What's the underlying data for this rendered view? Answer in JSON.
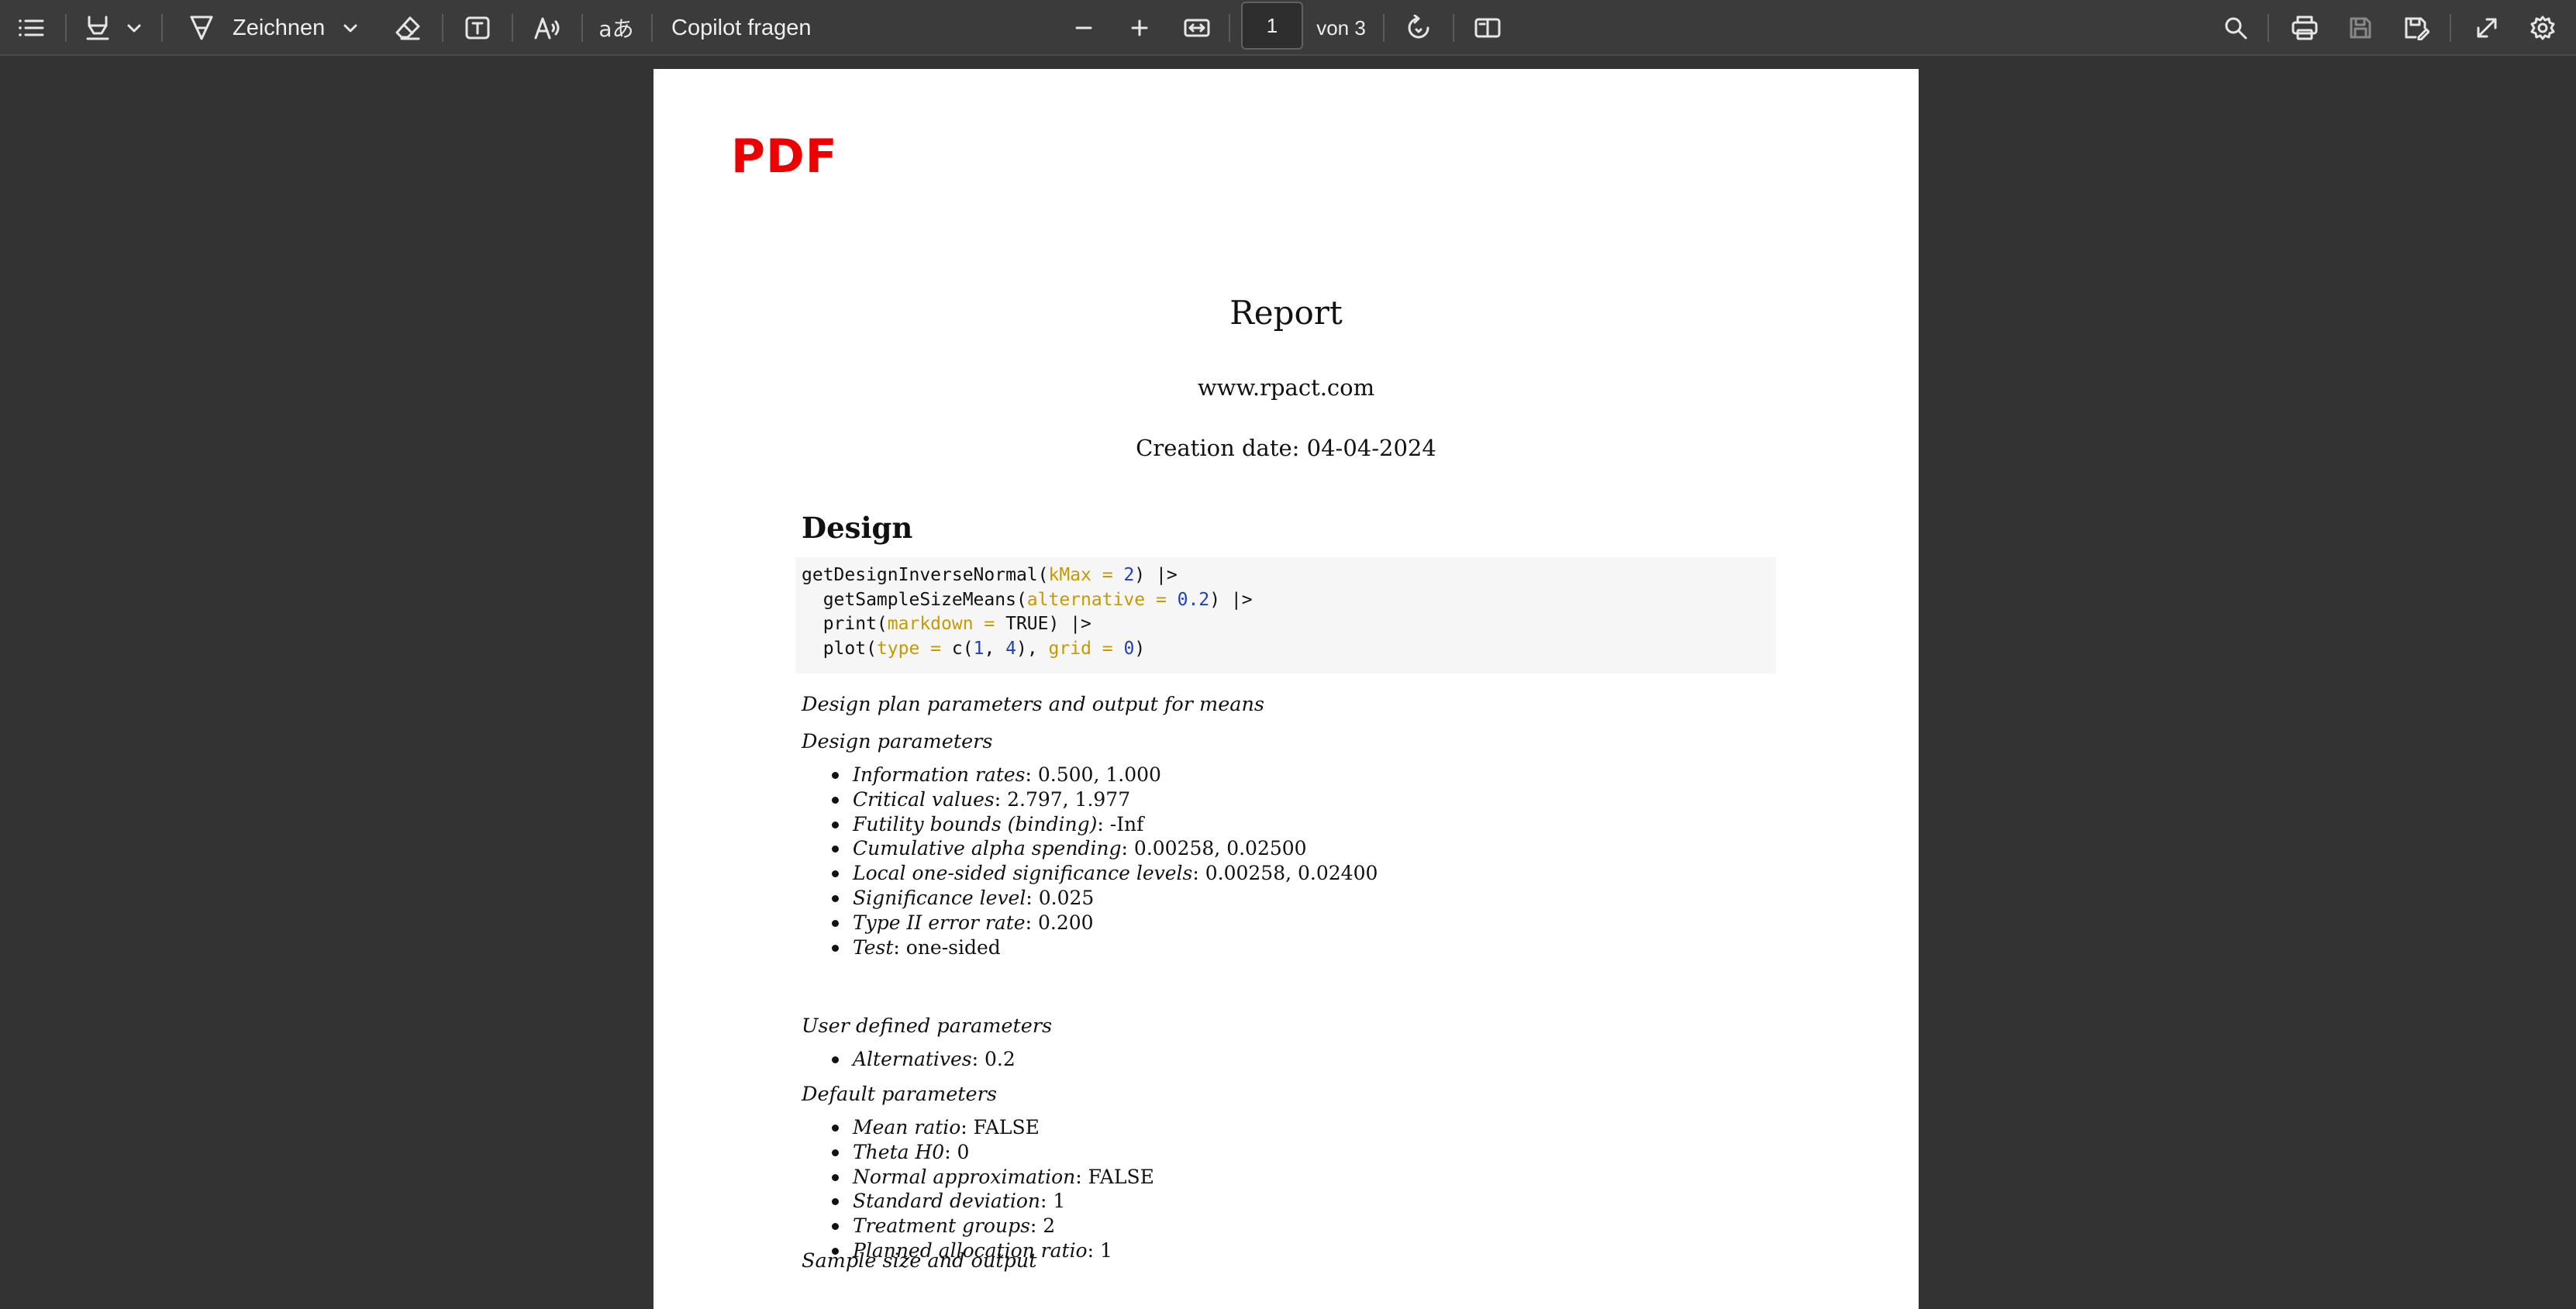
{
  "toolbar": {
    "draw_label": "Zeichnen",
    "copilot_label": "Copilot fragen",
    "page_number": "1",
    "page_total": "von 3",
    "icons": [
      "list-icon",
      "highlighter-icon",
      "chevron-down-icon",
      "draw-icon",
      "chevron-down-icon",
      "eraser-icon",
      "text-box-icon",
      "read-aloud-icon",
      "translate-icon",
      "zoom-out-icon",
      "zoom-in-icon",
      "fit-width-icon",
      "rotate-icon",
      "page-view-icon",
      "search-icon",
      "print-icon",
      "save-icon",
      "save-as-icon",
      "fullscreen-icon",
      "settings-icon"
    ]
  },
  "document": {
    "logo": "PDF",
    "title": "Report",
    "url": "www.rpact.com",
    "creation_date": "Creation date: 04-04-2024",
    "design_heading": "Design",
    "code": {
      "line1": {
        "fn": "getDesignInverseNormal(",
        "arg": "kMax = ",
        "num": "2",
        "rest": ") |>"
      },
      "line2": {
        "fn": "  getSampleSizeMeans(",
        "arg": "alternative = ",
        "num": "0.2",
        "rest": ") |>"
      },
      "line3": {
        "fn": "  print(",
        "arg": "markdown = ",
        "rest": "TRUE) |>"
      },
      "line4": {
        "fn": "  plot(",
        "arg1": "type = ",
        "mid1": "c(",
        "num1": "1",
        "mid2": ", ",
        "num2": "4",
        "mid3": "), ",
        "arg2": "grid = ",
        "num3": "0",
        "rest": ")"
      }
    },
    "design_plan_caption": "Design plan parameters and output for means",
    "design_parameters_heading": "Design parameters",
    "design_parameters": [
      {
        "label": "Information rates",
        "value": ": 0.500, 1.000"
      },
      {
        "label": "Critical values",
        "value": ": 2.797, 1.977"
      },
      {
        "label": "Futility bounds (binding)",
        "value": ": -Inf"
      },
      {
        "label": "Cumulative alpha spending",
        "value": ": 0.00258, 0.02500"
      },
      {
        "label": "Local one-sided significance levels",
        "value": ": 0.00258, 0.02400"
      },
      {
        "label": "Significance level",
        "value": ": 0.025"
      },
      {
        "label": "Type II error rate",
        "value": ": 0.200"
      },
      {
        "label": "Test",
        "value": ": one-sided"
      }
    ],
    "user_defined_heading": "User defined parameters",
    "user_defined_parameters": [
      {
        "label": "Alternatives",
        "value": ": 0.2"
      }
    ],
    "default_heading": "Default parameters",
    "default_parameters": [
      {
        "label": "Mean ratio",
        "value": ": FALSE"
      },
      {
        "label": "Theta H0",
        "value": ": 0"
      },
      {
        "label": "Normal approximation",
        "value": ": FALSE"
      },
      {
        "label": "Standard deviation",
        "value": ": 1"
      },
      {
        "label": "Treatment groups",
        "value": ": 2"
      },
      {
        "label": "Planned allocation ratio",
        "value": ": 1"
      }
    ],
    "sample_size_heading": "Sample size and output"
  }
}
